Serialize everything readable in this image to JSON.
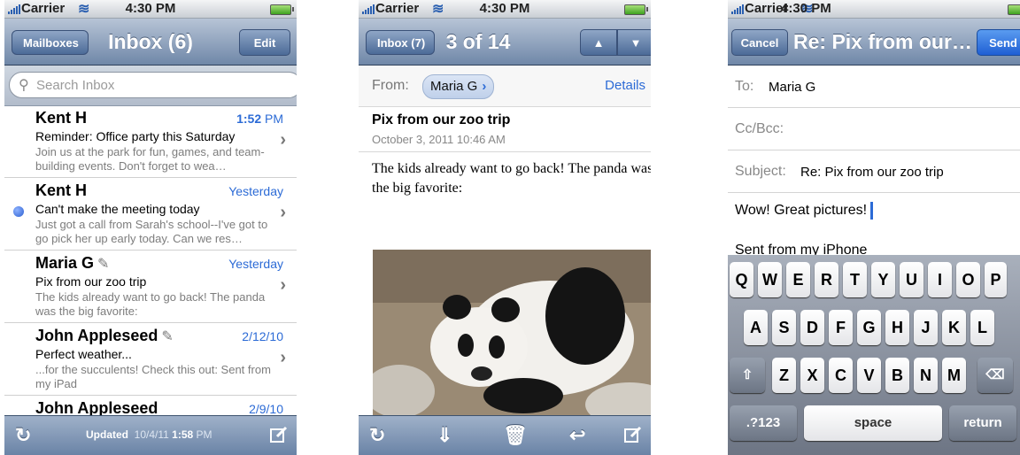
{
  "status": {
    "carrier": "Carrier",
    "time": "4:30 PM"
  },
  "inbox": {
    "back_label": "Mailboxes",
    "title": "Inbox (6)",
    "edit_label": "Edit",
    "search_placeholder": "Search Inbox",
    "messages": [
      {
        "sender": "Kent H",
        "date": "1:52",
        "date_suffix": "PM",
        "subject": "Reminder: Office party this Saturday",
        "preview": "Join us at the park for fun, games, and team-building events. Don't forget to wea…",
        "unread": false,
        "attachment": false
      },
      {
        "sender": "Kent H",
        "date": "Yesterday",
        "date_suffix": "",
        "subject": "Can't make the meeting today",
        "preview": "Just got a call from Sarah's school--I've got to go pick her up early today. Can we res…",
        "unread": true,
        "attachment": false
      },
      {
        "sender": "Maria G",
        "date": "Yesterday",
        "date_suffix": "",
        "subject": "Pix from our zoo trip",
        "preview": "The kids already want to go back! The panda was the big favorite:",
        "unread": false,
        "attachment": true
      },
      {
        "sender": "John Appleseed",
        "date": "2/12/10",
        "date_suffix": "",
        "subject": "Perfect weather...",
        "preview": "...for the succulents! Check this out: Sent from my iPad",
        "unread": false,
        "attachment": true
      },
      {
        "sender": "John Appleseed",
        "date": "2/9/10",
        "date_suffix": "",
        "subject": "",
        "preview": "",
        "unread": false,
        "attachment": false
      }
    ],
    "toolbar": {
      "updated_label": "Updated",
      "updated_date": "10/4/11",
      "updated_time": "1:58",
      "updated_suffix": "PM"
    }
  },
  "message": {
    "back_label": "Inbox (7)",
    "title": "3 of 14",
    "from_label": "From:",
    "from_name": "Maria G",
    "details_label": "Details",
    "subject": "Pix from our zoo trip",
    "date": "October 3, 2011 10:46 AM",
    "body": "The kids already want to go back! The panda was the big favorite:"
  },
  "compose": {
    "cancel_label": "Cancel",
    "title": "Re: Pix from our…",
    "send_label": "Send",
    "to_label": "To:",
    "to_value": "Maria G",
    "ccbcc_label": "Cc/Bcc:",
    "subject_label": "Subject:",
    "subject_value": "Re: Pix from our zoo trip",
    "body_text": "Wow! Great pictures!",
    "signature": "Sent from my iPhone",
    "keyboard": {
      "row1": [
        "Q",
        "W",
        "E",
        "R",
        "T",
        "Y",
        "U",
        "I",
        "O",
        "P"
      ],
      "row2": [
        "A",
        "S",
        "D",
        "F",
        "G",
        "H",
        "J",
        "K",
        "L"
      ],
      "row3": [
        "Z",
        "X",
        "C",
        "V",
        "B",
        "N",
        "M"
      ],
      "numbers_label": ".?123",
      "space_label": "space",
      "return_label": "return"
    }
  },
  "colors": {
    "accent": "#2c6bd6",
    "navbar": "#6f87a8",
    "unread_dot": "#2b5fd1"
  }
}
